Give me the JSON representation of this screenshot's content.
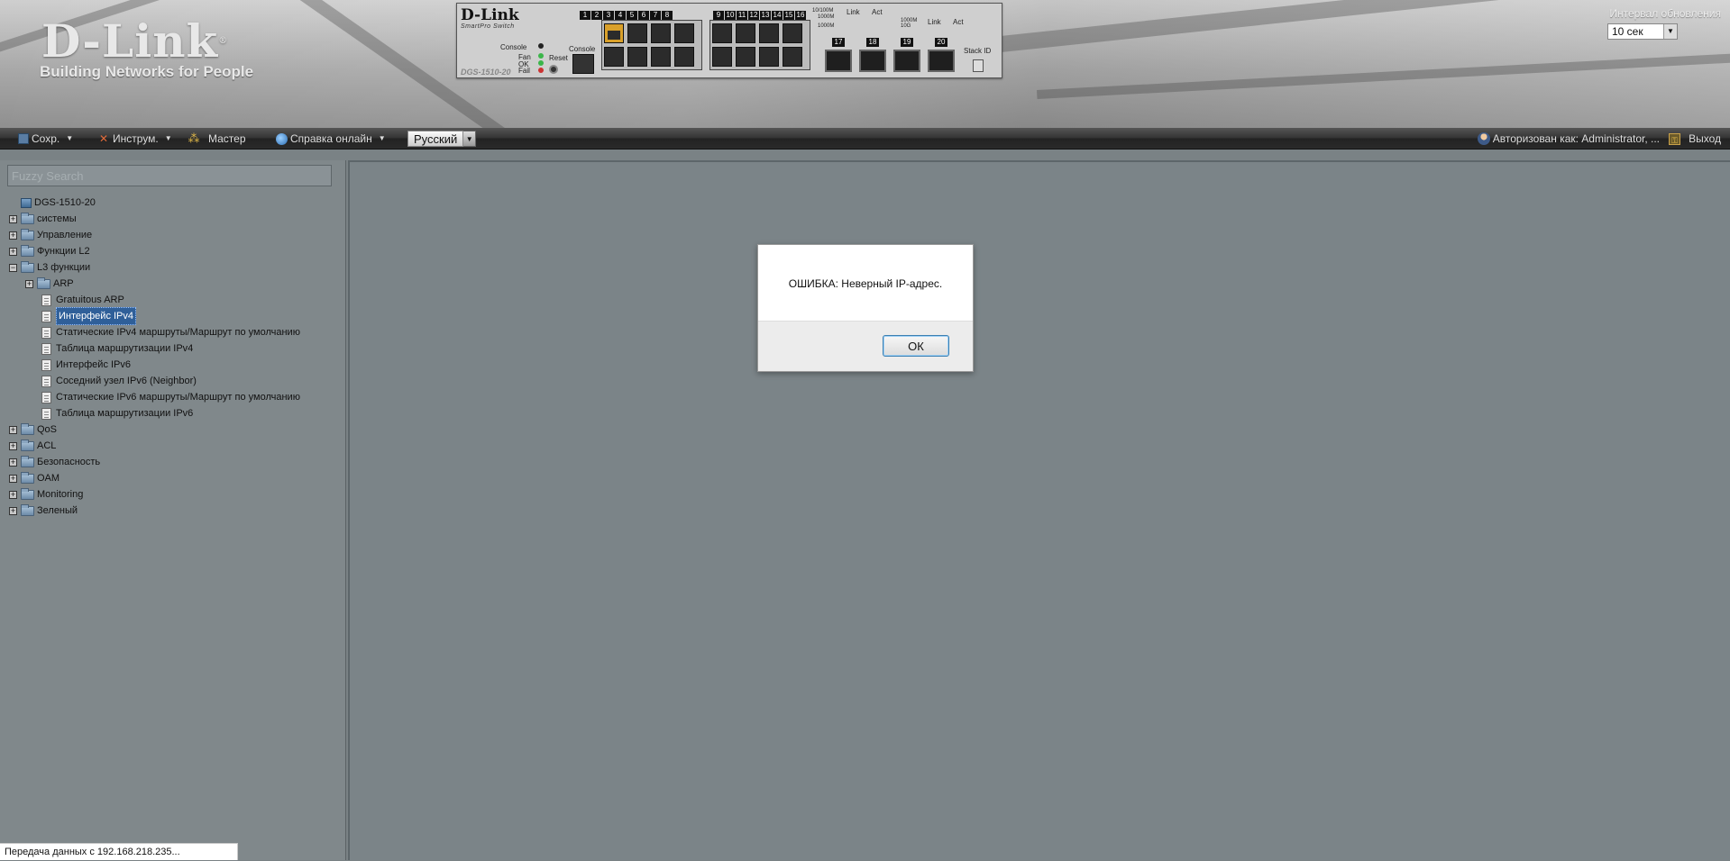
{
  "header": {
    "logo_brand": "D-Link",
    "logo_tagline": "Building Networks for People",
    "device": {
      "brand": "D-Link",
      "subtitle": "SmartPro Switch",
      "model": "DGS-1510-20",
      "labels": {
        "console": "Console",
        "fan": "Fan",
        "ok": "OK",
        "fail": "Fail",
        "reset": "Reset",
        "console_port": "Console",
        "stack_id": "Stack ID",
        "legend_1": "10/100M",
        "legend_2": "1000M",
        "legend_3": "1000M",
        "legend_link": "Link",
        "legend_act": "Act",
        "sfp_legend_speed": "1000M",
        "sfp_legend_speed2": "10G",
        "sfp_legend_link": "Link",
        "sfp_legend_act": "Act"
      },
      "ports_top": [
        "1",
        "2",
        "3",
        "4",
        "5",
        "6",
        "7",
        "8"
      ],
      "ports_mid": [
        "9",
        "10",
        "11",
        "12",
        "13",
        "14",
        "15",
        "16"
      ],
      "sfp_ports": [
        "17",
        "18",
        "19",
        "20"
      ],
      "active_ports": [
        1,
        5
      ]
    },
    "refresh": {
      "label": "Интервал обновления",
      "value": "10 сек"
    }
  },
  "toolbar": {
    "save": "Сохр.",
    "tools": "Инструм.",
    "wizard": "Мастер",
    "help": "Справка онлайн",
    "language": "Русский",
    "logged_in": "Авторизован как: Administrator, ...",
    "logout": "Выход"
  },
  "sidebar": {
    "search_placeholder": "Fuzzy Search",
    "tree": [
      {
        "label": "DGS-1510-20",
        "level": 0,
        "type": "root"
      },
      {
        "label": "системы",
        "level": 0,
        "type": "folder",
        "expanded": false
      },
      {
        "label": "Управление",
        "level": 0,
        "type": "folder",
        "expanded": false
      },
      {
        "label": "Функции L2",
        "level": 0,
        "type": "folder",
        "expanded": false
      },
      {
        "label": "L3 функции",
        "level": 0,
        "type": "folder",
        "expanded": true
      },
      {
        "label": "ARP",
        "level": 1,
        "type": "folder",
        "expanded": false
      },
      {
        "label": "Gratuitous ARP",
        "level": 1,
        "type": "doc"
      },
      {
        "label": "Интерфейс IPv4",
        "level": 1,
        "type": "doc",
        "selected": true
      },
      {
        "label": "Статические IPv4 маршруты/Маршрут по умолчанию",
        "level": 1,
        "type": "doc"
      },
      {
        "label": "Таблица маршрутизации IPv4",
        "level": 1,
        "type": "doc"
      },
      {
        "label": "Интерфейс IPv6",
        "level": 1,
        "type": "doc"
      },
      {
        "label": "Соседний узел IPv6 (Neighbor)",
        "level": 1,
        "type": "doc"
      },
      {
        "label": "Статические IPv6 маршруты/Маршрут по умолчанию",
        "level": 1,
        "type": "doc"
      },
      {
        "label": "Таблица маршрутизации IPv6",
        "level": 1,
        "type": "doc"
      },
      {
        "label": "QoS",
        "level": 0,
        "type": "folder",
        "expanded": false
      },
      {
        "label": "ACL",
        "level": 0,
        "type": "folder",
        "expanded": false
      },
      {
        "label": "Безопасность",
        "level": 0,
        "type": "folder",
        "expanded": false
      },
      {
        "label": "OAM",
        "level": 0,
        "type": "folder",
        "expanded": false
      },
      {
        "label": "Monitoring",
        "level": 0,
        "type": "folder",
        "expanded": false
      },
      {
        "label": "Зеленый",
        "level": 0,
        "type": "folder",
        "expanded": false
      }
    ]
  },
  "dialog": {
    "message": "ОШИБКА: Неверный IP-адрес.",
    "ok_label": "ОК"
  },
  "status_bar": {
    "text": "Передача данных с 192.168.218.235..."
  },
  "colors": {
    "toolbar_bg": "#2a2a2a",
    "sidebar_bg": "#80888b",
    "content_bg": "#7b8488",
    "selection": "#2f5f99",
    "port_active": "#d9a02a"
  }
}
